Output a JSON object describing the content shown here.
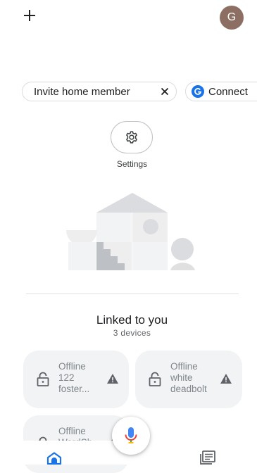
{
  "top_bar": {
    "add_icon": "plus-icon",
    "avatar_initial": "G",
    "avatar_color": "#8d6e63"
  },
  "chips": {
    "invite_label": "Invite home member",
    "invite_close_icon": "close-icon",
    "connect_label": "Connect",
    "connect_icon": "google-g-icon"
  },
  "settings": {
    "icon": "gear-icon",
    "label": "Settings"
  },
  "illustration": {
    "icon": "home-illustration"
  },
  "linked": {
    "title": "Linked to you",
    "count": "3 devices"
  },
  "devices": [
    {
      "status": "Offline",
      "name": "122 foster...",
      "icon": "lock-icon",
      "warning_icon": "warning-icon"
    },
    {
      "status": "Offline",
      "name": "white deadbolt",
      "icon": "lock-icon",
      "warning_icon": "warning-icon"
    },
    {
      "status": "Offline",
      "name": "WardSh...",
      "icon": "lock-icon",
      "warning_icon": "warning-icon"
    }
  ],
  "assistant": {
    "icon": "microphone-icon"
  },
  "nav": {
    "home_icon": "home-icon",
    "feed_icon": "feed-icon"
  },
  "colors": {
    "accent_blue": "#1a73e8",
    "card_bg": "#f1f3f4",
    "muted_text": "#80868b"
  }
}
